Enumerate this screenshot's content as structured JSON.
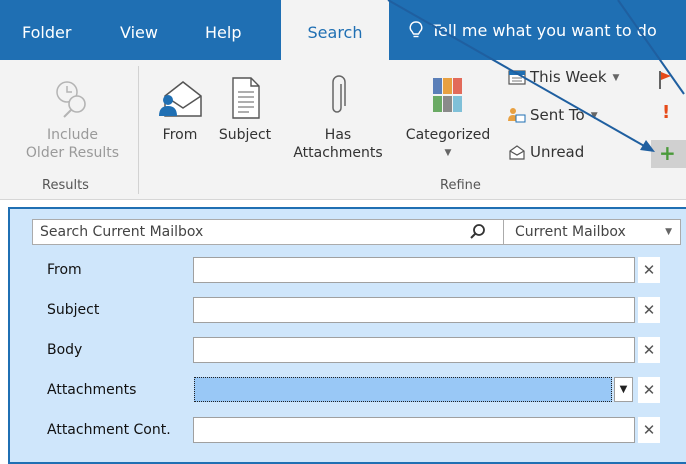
{
  "tabs": [
    {
      "label": "Folder"
    },
    {
      "label": "View"
    },
    {
      "label": "Help"
    },
    {
      "label": "Search",
      "active": true
    }
  ],
  "tell_me": "Tell me what you want to do",
  "ribbon": {
    "include_older": {
      "line1": "Include",
      "line2": "Older Results"
    },
    "from": "From",
    "subject": "Subject",
    "has_attachments": {
      "line1": "Has",
      "line2": "Attachments"
    },
    "categorized": "Categorized",
    "this_week": "This Week",
    "sent_to": "Sent To",
    "unread": "Unread",
    "exclamation": "!",
    "plus": "+",
    "groups": {
      "results": "Results",
      "refine": "Refine"
    }
  },
  "search": {
    "placeholder": "Search Current Mailbox",
    "scope": "Current Mailbox"
  },
  "fields": [
    {
      "label": "From",
      "value": ""
    },
    {
      "label": "Subject",
      "value": ""
    },
    {
      "label": "Body",
      "value": ""
    },
    {
      "label": "Attachments",
      "value": ""
    },
    {
      "label": "Attachment Cont.",
      "value": ""
    }
  ],
  "clear_glyph": "✕",
  "dropdown_glyph": "▼",
  "colors": {
    "accent": "#1f6fb3",
    "pane_bg": "#cfe6fb",
    "selected_field": "#99c8f6",
    "flag_red": "#e64a19",
    "plus_green": "#4a9a3a"
  }
}
